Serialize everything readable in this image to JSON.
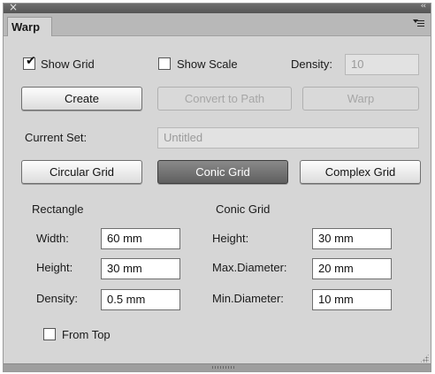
{
  "panel": {
    "close_glyph": "×",
    "collapse_glyph": "‹‹",
    "tab_label": "Warp"
  },
  "top_row": {
    "show_grid": {
      "label": "Show Grid",
      "checked": true
    },
    "show_scale": {
      "label": "Show Scale",
      "checked": false
    },
    "density_label": "Density:",
    "density_value": "10"
  },
  "buttons": {
    "create": "Create",
    "convert_to_path": "Convert to Path",
    "warp": "Warp"
  },
  "current_set": {
    "label": "Current Set:",
    "value": "Untitled"
  },
  "grid_types": {
    "circular": "Circular Grid",
    "conic": "Conic Grid",
    "complex": "Complex Grid",
    "selected": "conic"
  },
  "rectangle": {
    "title": "Rectangle",
    "width_label": "Width:",
    "width_value": "60 mm",
    "height_label": "Height:",
    "height_value": "30 mm",
    "density_label": "Density:",
    "density_value": "0.5 mm"
  },
  "conic_grid": {
    "title": "Conic Grid",
    "height_label": "Height:",
    "height_value": "30 mm",
    "max_label": "Max.Diameter:",
    "max_value": "20 mm",
    "min_label": "Min.Diameter:",
    "min_value": "10 mm"
  },
  "from_top": {
    "label": "From Top",
    "checked": false
  }
}
